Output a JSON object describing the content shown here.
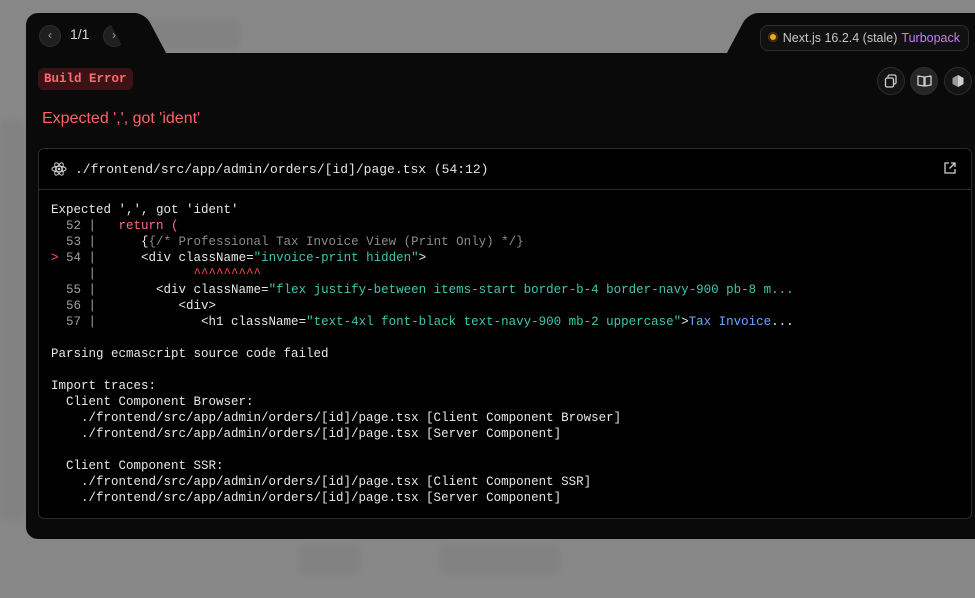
{
  "pager": {
    "count": "1/1",
    "prev_icon": "chevron-left-icon",
    "next_icon": "chevron-right-icon"
  },
  "version": {
    "label": "Next.js 16.2.4 (stale)",
    "bundler": "Turbopack",
    "status_color": "#f5a623"
  },
  "dialog": {
    "badge": "Build Error",
    "title": "Expected ',', got 'ident'",
    "toolbar": [
      "copy-icon",
      "docs-book-icon",
      "nextjs-logo-icon"
    ]
  },
  "frame": {
    "file": "./frontend/src/app/admin/orders/[id]/page.tsx (54:12)",
    "lines": {
      "l0": "Expected ',', got 'ident'",
      "l52_num": "  52 |",
      "l52_code": "return (",
      "l53_num": "  53 |",
      "l53_code": "{/* Professional Tax Invoice View (Print Only) */}",
      "l54_marker": ">",
      "l54_num": " 54 |",
      "l54_a": "<div className=",
      "l54_str": "\"invoice-print hidden\"",
      "l54_b": ">",
      "caret_num": "     |",
      "caret": "^^^^^^^^^",
      "l55_num": "  55 |",
      "l55_a": "<div className=",
      "l55_str": "\"flex justify-between items-start border-b-4 border-navy-900 pb-8 m...",
      "l56_num": "  56 |",
      "l56_code": "<div>",
      "l57_num": "  57 |",
      "l57_a": "<h1 className=",
      "l57_str": "\"text-4xl font-black text-navy-900 mb-2 uppercase\"",
      "l57_b": ">",
      "l57_link": "Tax Invoice",
      "l57_c": "...",
      "parse_fail": "Parsing ecmascript source code failed",
      "imports": "Import traces:",
      "browser_head": "  Client Component Browser:",
      "browser_1": "    ./frontend/src/app/admin/orders/[id]/page.tsx [Client Component Browser]",
      "browser_2": "    ./frontend/src/app/admin/orders/[id]/page.tsx [Server Component]",
      "ssr_head": "  Client Component SSR:",
      "ssr_1": "    ./frontend/src/app/admin/orders/[id]/page.tsx [Client Component SSR]",
      "ssr_2": "    ./frontend/src/app/admin/orders/[id]/page.tsx [Server Component]"
    }
  }
}
